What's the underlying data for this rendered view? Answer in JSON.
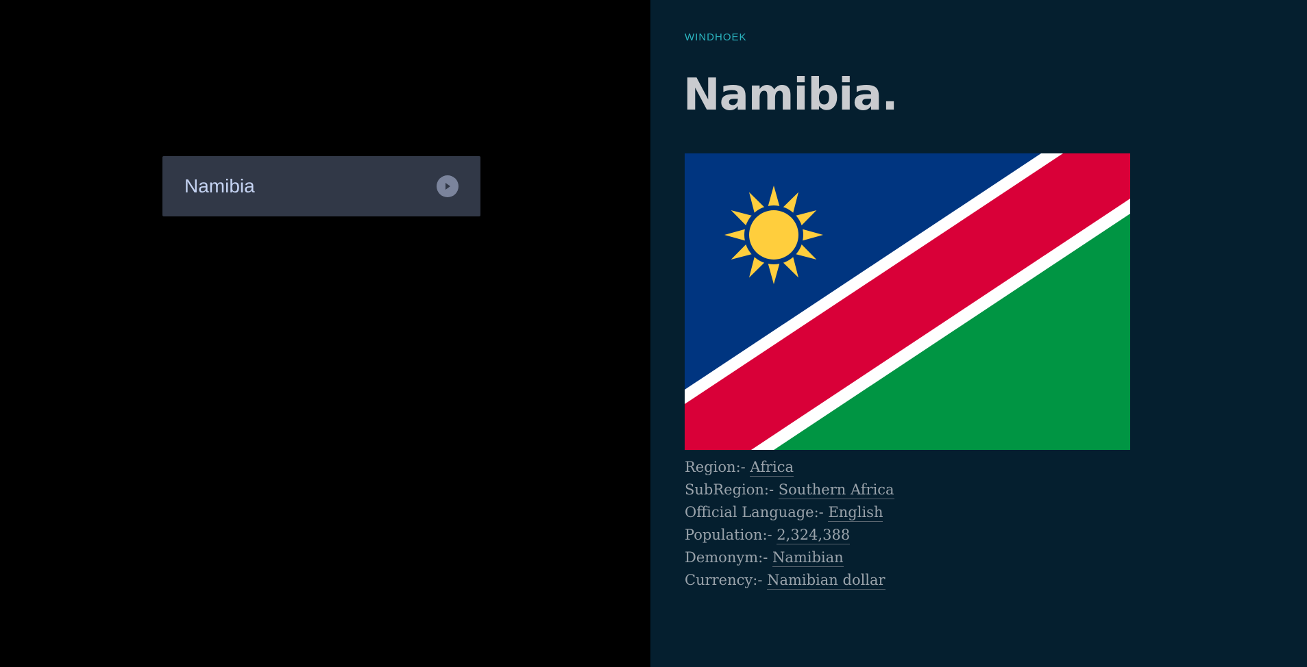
{
  "selector": {
    "selected_label": "Namibia",
    "arrow_icon": "caret-right-icon"
  },
  "detail": {
    "capital": "WINDHOEK",
    "title": "Namibia.",
    "flag_icon": "namibia-flag",
    "colors": {
      "flag_blue": "#003580",
      "flag_red": "#d90038",
      "flag_green": "#009543",
      "flag_white": "#ffffff",
      "flag_sun": "#ffce3d",
      "panel_bg": "#051f2f",
      "accent": "#2bb5c0"
    },
    "facts": [
      {
        "label": "Region:-",
        "value": "Africa"
      },
      {
        "label": "SubRegion:-",
        "value": "Southern Africa"
      },
      {
        "label": "Official Language:-",
        "value": "English"
      },
      {
        "label": "Population:-",
        "value": "2,324,388"
      },
      {
        "label": "Demonym:-",
        "value": "Namibian"
      },
      {
        "label": "Currency:-",
        "value": "Namibian dollar"
      }
    ]
  }
}
